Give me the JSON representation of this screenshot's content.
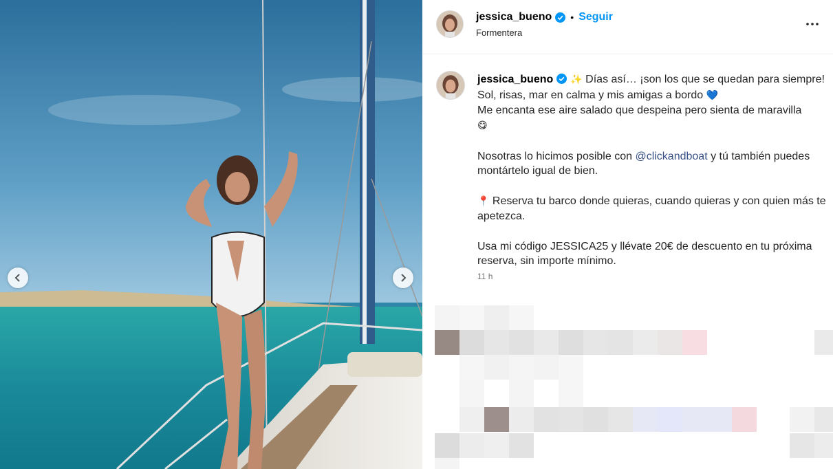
{
  "post": {
    "username": "jessica_bueno",
    "follow_label": "Seguir",
    "separator": "•",
    "location": "Formentera",
    "more_icon": "more-options-icon",
    "verified_color": "#0095f6"
  },
  "caption": {
    "username": "jessica_bueno",
    "line1_emoji": "✨",
    "line1_text": "Días así… ¡son los que se quedan para siempre!",
    "line2_text": "Sol, risas, mar en calma y mis amigas a bordo",
    "line2_emoji": "💙",
    "line3_text": "Me encanta ese aire salado que despeina pero sienta de maravilla",
    "line3_emoji": "😋",
    "para2_before": "Nosotras lo hicimos posible con",
    "para2_mention": "@clickandboat",
    "para2_after": "y tú también puedes montártelo igual de bien.",
    "para3_emoji": "📍",
    "para3_text": "Reserva tu barco donde quieras, cuando quieras y con quien más te apetezca.",
    "para4_text": "Usa mi código JESSICA25 y llévate 20€ de descuento en tu próxima reserva, sin importe mínimo.",
    "time": "11 h"
  },
  "carousel": {
    "prev_icon": "chevron-left-icon",
    "next_icon": "chevron-right-icon"
  },
  "colors": {
    "accent": "#0095f6",
    "mention": "#385185",
    "muted": "#737373"
  }
}
